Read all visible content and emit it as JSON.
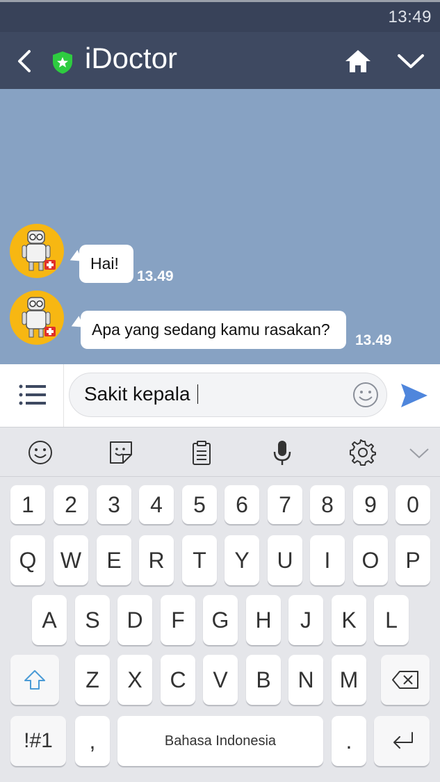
{
  "status": {
    "time": "13:49"
  },
  "header": {
    "title": "iDoctor"
  },
  "messages": [
    {
      "text": "Hai!",
      "time": "13.49"
    },
    {
      "text": "Apa yang sedang kamu rasakan?",
      "time": "13.49"
    }
  ],
  "composer": {
    "value": "Sakit kepala"
  },
  "keyboard": {
    "row_numbers": [
      "1",
      "2",
      "3",
      "4",
      "5",
      "6",
      "7",
      "8",
      "9",
      "0"
    ],
    "row_top": [
      "Q",
      "W",
      "E",
      "R",
      "T",
      "Y",
      "U",
      "I",
      "O",
      "P"
    ],
    "row_middle": [
      "A",
      "S",
      "D",
      "F",
      "G",
      "H",
      "J",
      "K",
      "L"
    ],
    "row_bottom": [
      "Z",
      "X",
      "C",
      "V",
      "B",
      "N",
      "M"
    ],
    "symbols_label": "!#1",
    "comma_label": ",",
    "space_label": "Bahasa Indonesia",
    "period_label": "."
  },
  "colors": {
    "status_bar": "#384259",
    "app_bar": "#3e4961",
    "chat_background": "#87a2c3",
    "avatar": "#f7b712",
    "send": "#4f86dc",
    "shield": "#2ecc40"
  }
}
